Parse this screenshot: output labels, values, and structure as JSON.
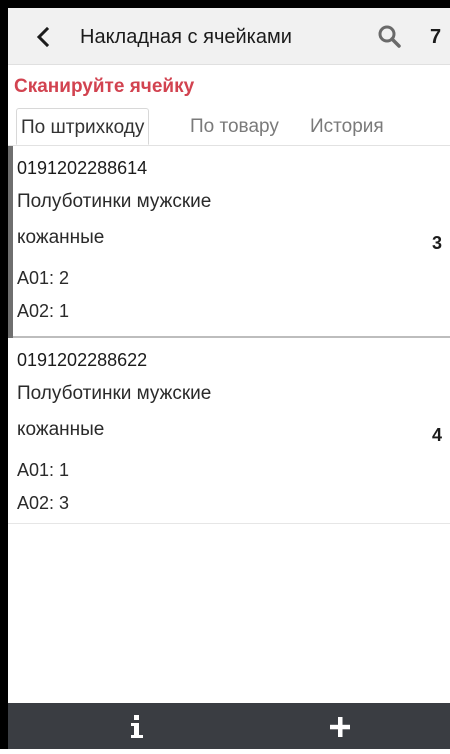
{
  "toolbar": {
    "title": "Накладная с ячейками",
    "count": "7",
    "back_icon": "chevron-left-icon",
    "search_icon": "search-icon"
  },
  "prompt": "Сканируйте ячейку",
  "tabs": [
    {
      "label": "По штрихкоду",
      "active": true
    },
    {
      "label": "По товару",
      "active": false
    },
    {
      "label": "История",
      "active": false
    }
  ],
  "items": [
    {
      "barcode": "0191202288614",
      "name_line1": "Полуботинки мужские",
      "name_line2": "кожанные",
      "cells": [
        "A01: 2",
        "A02: 1"
      ],
      "qty": "3",
      "selected": true
    },
    {
      "barcode": "0191202288622",
      "name_line1": "Полуботинки мужские",
      "name_line2": "кожанные",
      "cells": [
        "A01: 1",
        "A02: 3"
      ],
      "qty": "4",
      "selected": false
    }
  ],
  "bottom_bar": {
    "info_icon": "info-icon",
    "add_icon": "plus-icon"
  },
  "colors": {
    "accent": "#d24350",
    "toolbar_bg": "#f1f1f1",
    "bottom_bar_bg": "#3a3d42"
  }
}
